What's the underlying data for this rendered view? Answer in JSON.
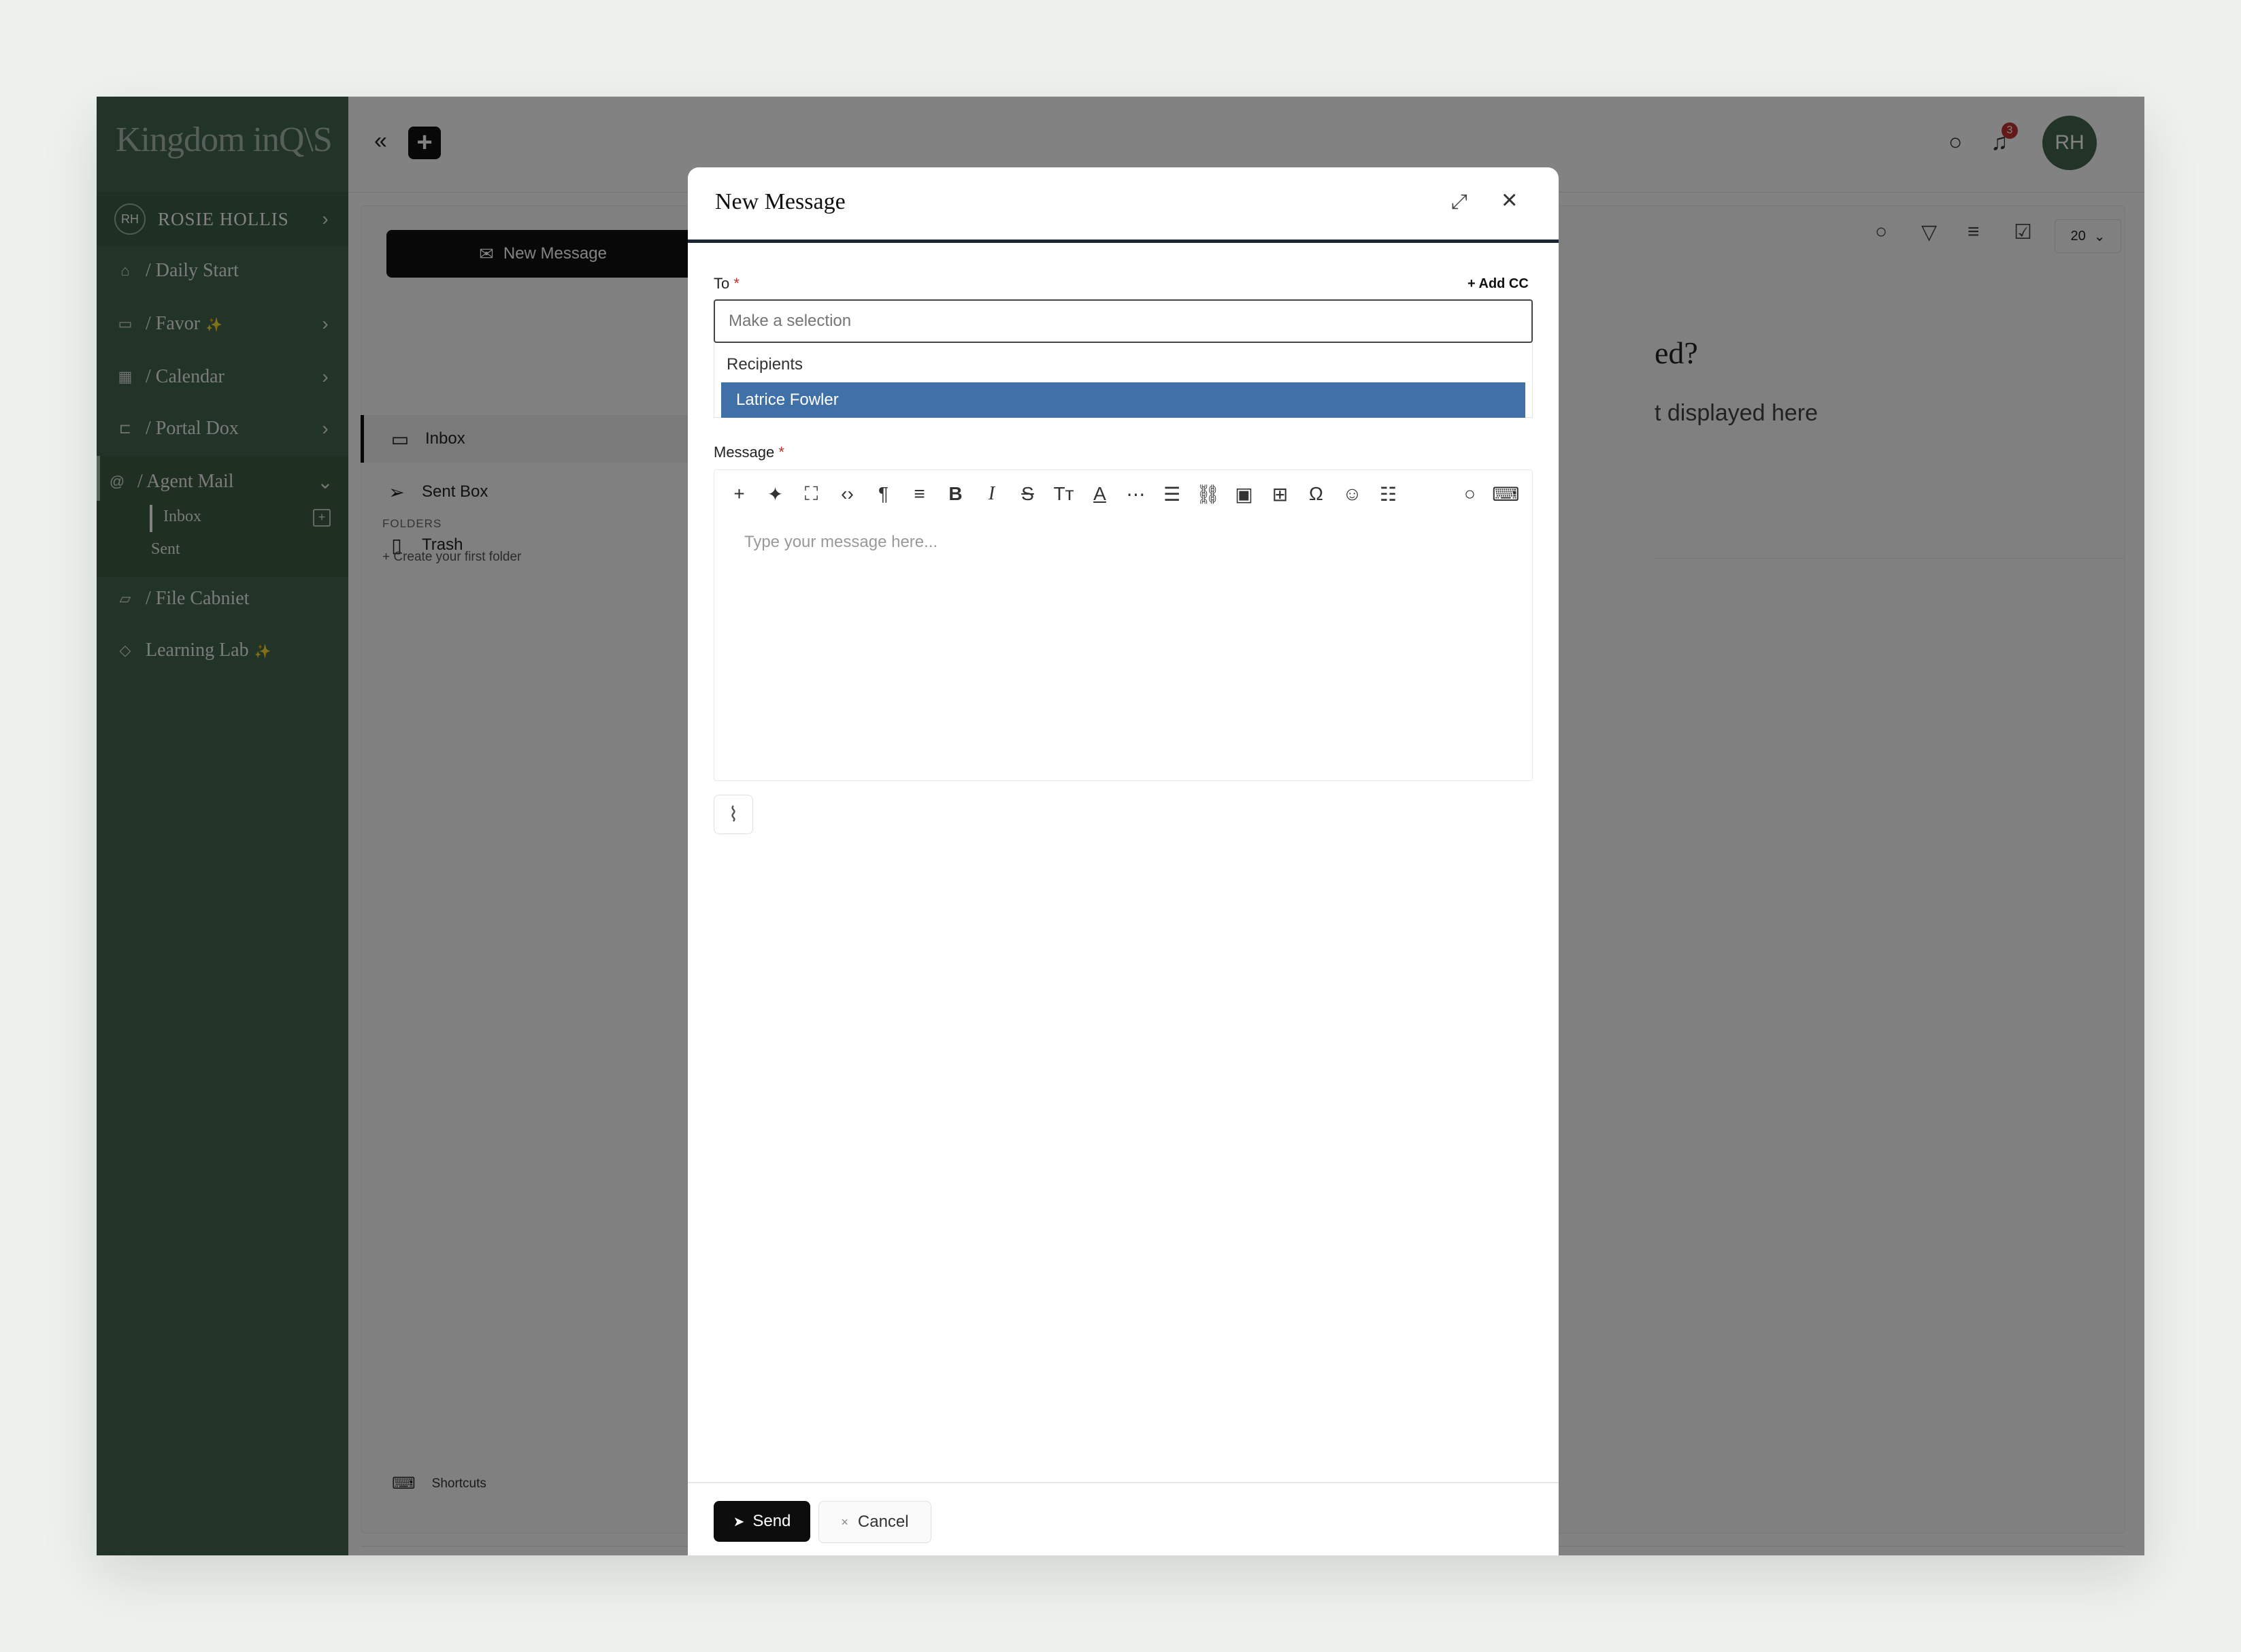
{
  "sidebar": {
    "logo": "Kingdom inQ\\S",
    "user": {
      "initials": "RH",
      "name": "ROSIE HOLLIS"
    },
    "items": [
      {
        "label": "/ Daily Start",
        "icon": "home-icon"
      },
      {
        "label": "/ Favor",
        "icon": "calendar-icon",
        "sparkle": "✨"
      },
      {
        "label": "/ Calendar",
        "icon": "calendar-icon"
      },
      {
        "label": "/ Portal Dox",
        "icon": "tree-icon"
      },
      {
        "label": "/ Agent Mail",
        "icon": "at-icon"
      },
      {
        "label": "/ File Cabniet",
        "icon": "folder-icon"
      },
      {
        "label": "Learning Lab",
        "icon": "graduation-cap-icon",
        "sparkle": "✨"
      }
    ],
    "agent_mail_sub": {
      "inbox": "Inbox",
      "sent": "Sent"
    }
  },
  "header": {
    "notifications": "3",
    "avatar_initials": "RH"
  },
  "mail": {
    "new_message_label": "New Message",
    "nav": [
      "Inbox",
      "Sent Box",
      "Trash"
    ],
    "folders_label": "FOLDERS",
    "create_folder": "+ Create your first folder",
    "shortcuts": "Shortcuts",
    "page_size": "20",
    "empty_heading": "ed?",
    "empty_sub": "t displayed here"
  },
  "modal": {
    "title": "New Message",
    "to_label": "To",
    "required_mark": "*",
    "add_cc": "+ Add CC",
    "to_placeholder": "Make a selection",
    "dropdown_group": "Recipients",
    "dropdown_option": "Latrice Fowler",
    "message_label": "Message",
    "message_placeholder": "Type your message here...",
    "send_label": "Send",
    "cancel_label": "Cancel"
  }
}
